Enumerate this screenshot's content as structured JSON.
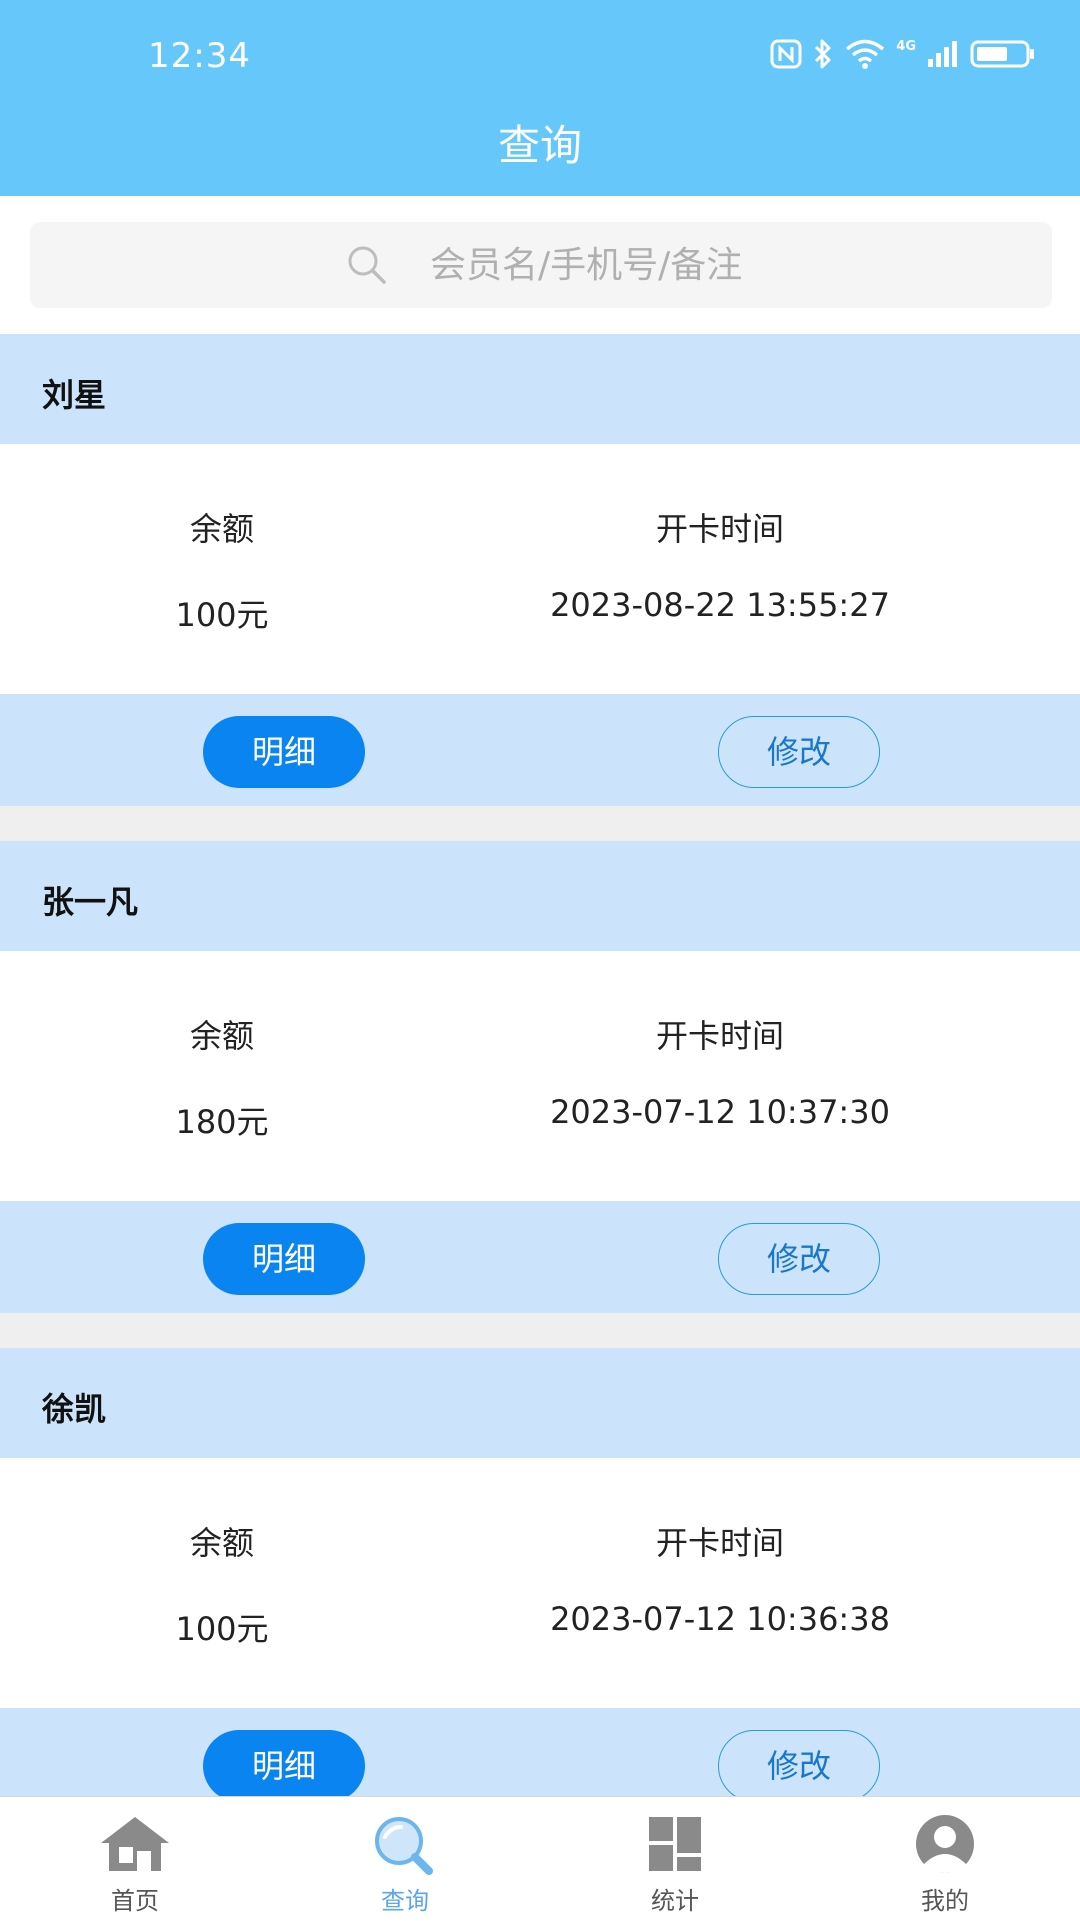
{
  "status_bar": {
    "time": "12:34",
    "network": "4G"
  },
  "header": {
    "title": "查询"
  },
  "search": {
    "placeholder": "会员名/手机号/备注"
  },
  "members": [
    {
      "name": "刘星",
      "balance_label": "余额",
      "balance": "100元",
      "open_label": "开卡时间",
      "open_time": "2023-08-22 13:55:27",
      "detail_label": "明细",
      "edit_label": "修改"
    },
    {
      "name": "张一凡",
      "balance_label": "余额",
      "balance": "180元",
      "open_label": "开卡时间",
      "open_time": "2023-07-12 10:37:30",
      "detail_label": "明细",
      "edit_label": "修改"
    },
    {
      "name": "徐凯",
      "balance_label": "余额",
      "balance": "100元",
      "open_label": "开卡时间",
      "open_time": "2023-07-12 10:36:38",
      "detail_label": "明细",
      "edit_label": "修改"
    }
  ],
  "tabs": [
    {
      "label": "首页",
      "icon": "home-icon",
      "active": false
    },
    {
      "label": "查询",
      "icon": "search-icon",
      "active": true
    },
    {
      "label": "统计",
      "icon": "grid-icon",
      "active": false
    },
    {
      "label": "我的",
      "icon": "user-icon",
      "active": false
    }
  ],
  "colors": {
    "header_bg": "#66c7fb",
    "card_band": "#cce4fb",
    "primary": "#0a84f0",
    "active_tab": "#5aa6e8",
    "inactive_tab": "#888888"
  }
}
